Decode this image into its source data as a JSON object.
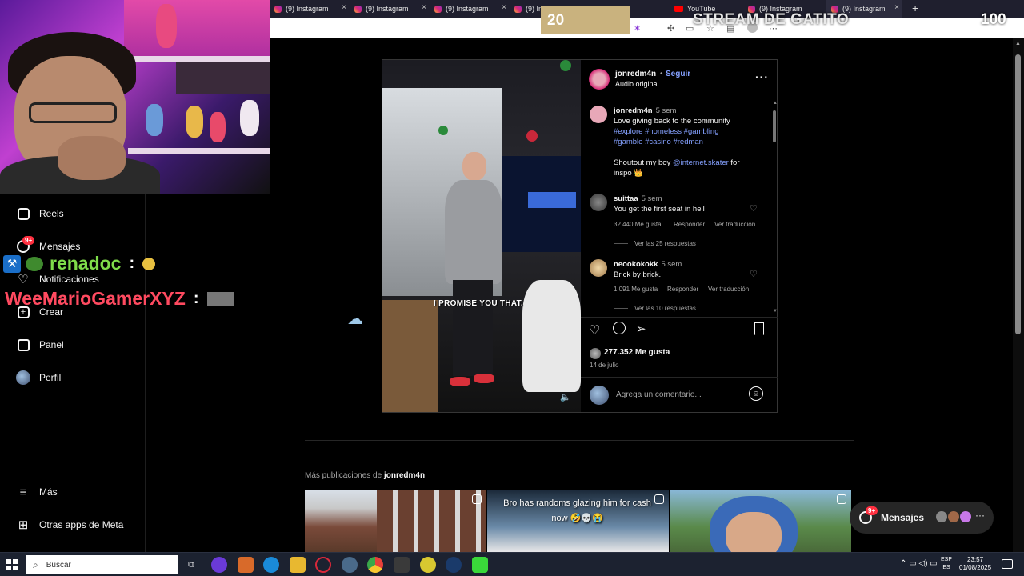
{
  "browser": {
    "tabs": [
      {
        "label": "(9) Instagram",
        "icon": "instagram-icon"
      },
      {
        "label": "(9) Instagram",
        "icon": "instagram-icon"
      },
      {
        "label": "(9) Instagram",
        "icon": "instagram-icon"
      },
      {
        "label": "(9) In",
        "icon": "instagram-icon"
      },
      {
        "label": "YouTube",
        "icon": "youtube-icon"
      },
      {
        "label": "(9) Instagram",
        "icon": "instagram-icon"
      },
      {
        "label": "(9) Instagram",
        "icon": "instagram-icon"
      }
    ],
    "new_tab": "+"
  },
  "stream_overlay": {
    "left_counter": "20",
    "title": "STREAM DE GATITO",
    "right_counter": "100"
  },
  "nav": {
    "items": [
      {
        "label": "Reels",
        "icon": "reels-icon"
      },
      {
        "label": "Mensajes",
        "icon": "messenger-icon",
        "badge": "9+"
      },
      {
        "label": "Notificaciones",
        "icon": "heart-icon"
      },
      {
        "label": "Crear",
        "icon": "plus-square-icon"
      },
      {
        "label": "Panel",
        "icon": "bar-chart-icon"
      },
      {
        "label": "Perfil",
        "icon": "avatar-icon"
      },
      {
        "label": "Más",
        "icon": "hamburger-icon"
      },
      {
        "label": "Otras apps de Meta",
        "icon": "meta-apps-icon"
      }
    ]
  },
  "chat": [
    {
      "user": "renadoc",
      "sep": ":"
    },
    {
      "user": "WeeMarioGamerXYZ",
      "sep": ":"
    }
  ],
  "post": {
    "video_caption": "I PROMISE YOU THAT.",
    "header": {
      "username": "jonredm4n",
      "dot": "•",
      "follow": "Seguir",
      "audio": "Audio original"
    },
    "caption": {
      "user": "jonredm4n",
      "time": "5 sem",
      "line1": "Love giving back to the community",
      "tags1": "#explore #homeless #gambling",
      "tags2": "#gamble #casino #redman",
      "shout_pre": "Shoutout my boy ",
      "shout_tag": "@internet.skater",
      "shout_post": " for",
      "shout_end": "inspo 👑"
    },
    "comments": [
      {
        "user": "suittaa",
        "time": "5 sem",
        "text": "You get the first seat in hell",
        "likes": "32.440 Me gusta",
        "reply": "Responder",
        "translate": "Ver traducción",
        "replies": "Ver las 25 respuestas"
      },
      {
        "user": "neookokokk",
        "time": "5 sem",
        "text": "Brick by brick.",
        "likes": "1.091 Me gusta",
        "reply": "Responder",
        "translate": "Ver traducción",
        "replies": "Ver las 10 respuestas"
      }
    ],
    "likes": "277.352 Me gusta",
    "date": "14 de julio",
    "comment_placeholder": "Agrega un comentario..."
  },
  "more_posts": {
    "prefix": "Más publicaciones de ",
    "user": "jonredm4n",
    "thumb2_text": "Bro has randoms glazing him for cash now 🤣💀😭"
  },
  "messages_pill": {
    "label": "Mensajes",
    "badge": "9+",
    "more": "···"
  },
  "taskbar": {
    "search": "Buscar",
    "lang_top": "ESP",
    "lang_bottom": "ES",
    "time": "23:57",
    "date": "01/08/2025"
  },
  "colors": {
    "link_blue": "#85a1ff",
    "badge_red": "#ff3040",
    "chat_green": "#7fdc4a",
    "chat_red": "#ff4a60"
  }
}
